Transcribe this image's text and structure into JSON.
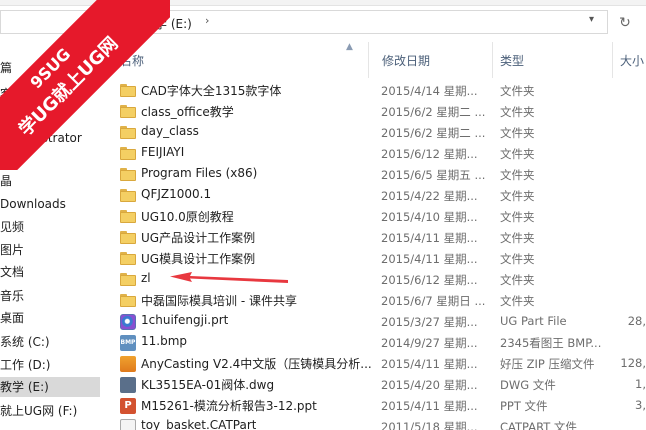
{
  "address": {
    "path": "教学 (E:)",
    "chev1": "›",
    "chev2": "›",
    "dropdown": "▾",
    "refresh_glyph": "↻"
  },
  "nav": {
    "items": [
      {
        "label": "篇"
      },
      {
        "label": "客"
      },
      {
        "label": "Administrator"
      },
      {
        "label": "晶"
      },
      {
        "label": "Downloads"
      },
      {
        "label": "见频"
      },
      {
        "label": "图片"
      },
      {
        "label": "文档"
      },
      {
        "label": "音乐"
      },
      {
        "label": "桌面"
      },
      {
        "label": "系统 (C:)"
      },
      {
        "label": "工作 (D:)"
      },
      {
        "label": "教学 (E:)",
        "selected": true
      },
      {
        "label": "就上UG网 (F:)"
      }
    ]
  },
  "columns": {
    "name": "名称",
    "date": "修改日期",
    "type": "类型",
    "size": "大小"
  },
  "files": [
    {
      "icon": "folder",
      "name": "CAD字体大全1315款字体",
      "date": "2015/4/14 星期...",
      "type": "文件夹",
      "size": ""
    },
    {
      "icon": "folder",
      "name": "class_office教学",
      "date": "2015/6/2 星期二 ...",
      "type": "文件夹",
      "size": ""
    },
    {
      "icon": "folder",
      "name": "day_class",
      "date": "2015/6/2 星期二 ...",
      "type": "文件夹",
      "size": ""
    },
    {
      "icon": "folder",
      "name": "FEIJIAYI",
      "date": "2015/6/12 星期...",
      "type": "文件夹",
      "size": ""
    },
    {
      "icon": "folder",
      "name": "Program Files (x86)",
      "date": "2015/6/5 星期五 ...",
      "type": "文件夹",
      "size": ""
    },
    {
      "icon": "folder",
      "name": "QFJZ1000.1",
      "date": "2015/4/22 星期...",
      "type": "文件夹",
      "size": ""
    },
    {
      "icon": "folder",
      "name": "UG10.0原创教程",
      "date": "2015/4/10 星期...",
      "type": "文件夹",
      "size": ""
    },
    {
      "icon": "folder",
      "name": "UG产品设计工作案例",
      "date": "2015/4/11 星期...",
      "type": "文件夹",
      "size": ""
    },
    {
      "icon": "folder",
      "name": "UG模具设计工作案例",
      "date": "2015/4/11 星期...",
      "type": "文件夹",
      "size": ""
    },
    {
      "icon": "folder",
      "name": "zl",
      "date": "2015/6/12 星期...",
      "type": "文件夹",
      "size": ""
    },
    {
      "icon": "folder",
      "name": "中磊国际模具培训 - 课件共享",
      "date": "2015/6/7 星期日 ...",
      "type": "文件夹",
      "size": ""
    },
    {
      "icon": "prt",
      "name": "1chuifengji.prt",
      "date": "2015/3/27 星期...",
      "type": "UG Part File",
      "size": "28,"
    },
    {
      "icon": "bmp",
      "icon_text": "BMP",
      "name": "11.bmp",
      "date": "2014/9/27 星期...",
      "type": "2345看图王 BMP...",
      "size": ""
    },
    {
      "icon": "zip",
      "name": "AnyCasting V2.4中文版（压铸模具分析...",
      "date": "2015/4/11 星期...",
      "type": "好压 ZIP 压缩文件",
      "size": "128,"
    },
    {
      "icon": "dwg",
      "name": "KL3515EA-01阀体.dwg",
      "date": "2015/4/20 星期...",
      "type": "DWG 文件",
      "size": "1,"
    },
    {
      "icon": "ppt",
      "icon_text": "P",
      "name": "M15261-模流分析報告3-12.ppt",
      "date": "2015/4/11 星期...",
      "type": "PPT 文件",
      "size": "3,"
    },
    {
      "icon": "cat",
      "name": "toy_basket.CATPart",
      "date": "2011/5/18 星期...",
      "type": "CATPART 文件",
      "size": ""
    }
  ],
  "watermark": {
    "line1": "9SUG",
    "line2": "学UG就上UG网",
    "color": "#e6192b"
  },
  "annotation": {
    "color": "#e8383f",
    "points_to": "zl"
  }
}
